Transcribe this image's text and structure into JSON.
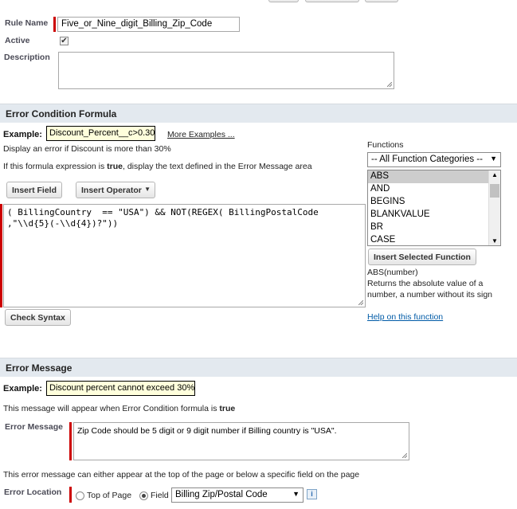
{
  "rule": {
    "name_label": "Rule Name",
    "name_value": "Five_or_Nine_digit_Billing_Zip_Code",
    "active_label": "Active",
    "active_checked": true,
    "description_label": "Description",
    "description_value": ""
  },
  "condition": {
    "section_title": "Error Condition Formula",
    "example_label": "Example:",
    "example_value": "Discount_Percent__c>0.30",
    "more_examples": "More Examples ...",
    "display_hint": "Display an error if Discount is more than 30%",
    "if_text_1": "If this formula expression is ",
    "if_text_bold": "true",
    "if_text_2": ", display the text defined in the Error Message area",
    "insert_field": "Insert Field",
    "insert_operator": "Insert Operator",
    "formula_line1": "( BillingCountry  == \"USA\") && NOT(REGEX( BillingPostalCode",
    "formula_line2": ",\"\\\\d{5}(-\\\\d{4})?\"))",
    "check_syntax": "Check Syntax"
  },
  "functions": {
    "label": "Functions",
    "category_selected": "-- All Function Categories --",
    "items": [
      "ABS",
      "AND",
      "BEGINS",
      "BLANKVALUE",
      "BR",
      "CASE"
    ],
    "insert_button": "Insert Selected Function",
    "signature": "ABS(number)",
    "desc_line1": "Returns the absolute value of a",
    "desc_line2": "number, a number without its sign",
    "help_link": "Help on this function"
  },
  "message": {
    "section_title": "Error Message",
    "example_label": "Example:",
    "example_value": "Discount percent cannot exceed 30%",
    "appear_text_1": "This message will appear when Error Condition formula is ",
    "appear_text_bold": "true",
    "field_label": "Error Message",
    "field_value": "Zip Code should be 5 digit or 9 digit number if Billing country is \"USA\".",
    "location_hint": "This error message can either appear at the top of the page or below a specific field on the page",
    "location_label": "Error Location",
    "option_top": "Top of Page",
    "option_field": "Field",
    "selected_option": "Field",
    "field_select_value": "Billing Zip/Postal Code",
    "info_icon_glyph": "i"
  },
  "colors": {
    "required_bar": "#cc0000",
    "section_bg": "#e3e9ef",
    "example_bg": "#ffffdc",
    "link": "#015ba7"
  }
}
